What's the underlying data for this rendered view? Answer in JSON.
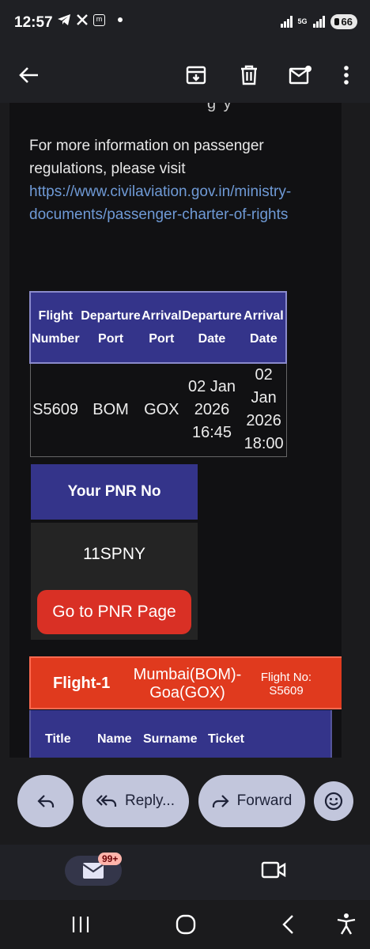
{
  "status_bar": {
    "time": "12:57",
    "notification_icon_text": "m",
    "network": "5G",
    "battery": "66"
  },
  "toolbar": {
    "back_icon": "arrow-left-icon",
    "archive_icon": "archive-icon",
    "delete_icon": "trash-icon",
    "unread_icon": "mark-unread-icon",
    "more_icon": "more-vert-icon"
  },
  "email": {
    "cut_text": "g y",
    "info_text": "For more information on passenger regulations, please visit",
    "link": "https://www.civilaviation.gov.in/ministry-documents/passenger-charter-of-rights",
    "flight_table": {
      "headers": [
        "Flight Number",
        "Departure Port",
        "Arrival Port",
        "Departure Date",
        "Arrival Date"
      ],
      "row": [
        "S5609",
        "BOM",
        "GOX",
        "02 Jan 2026 16:45",
        "02 Jan 2026 18:00"
      ]
    },
    "pnr": {
      "heading": "Your PNR No",
      "number": "11SPNY",
      "button": "Go to PNR Page"
    },
    "flight_bar": {
      "title": "Flight-1",
      "route": "Mumbai(BOM)-Goa(GOX)",
      "flight_no": "Flight No: S5609"
    },
    "passenger_headers": [
      "Title",
      "Name",
      "Surname",
      "Ticket"
    ]
  },
  "reply_bar": {
    "reply_icon": "reply-icon",
    "reply_all_label": "Reply...",
    "forward_label": "Forward",
    "emoji_icon": "emoji-icon"
  },
  "bottom_nav": {
    "mail_badge": "99+",
    "mail_icon": "mail-icon",
    "video_icon": "video-icon"
  },
  "colors": {
    "table_header": "#34348a",
    "accent_red": "#d93025",
    "flight_bar": "#e03a1e",
    "link": "#6f9ad6",
    "pill": "#c2c6dc"
  }
}
